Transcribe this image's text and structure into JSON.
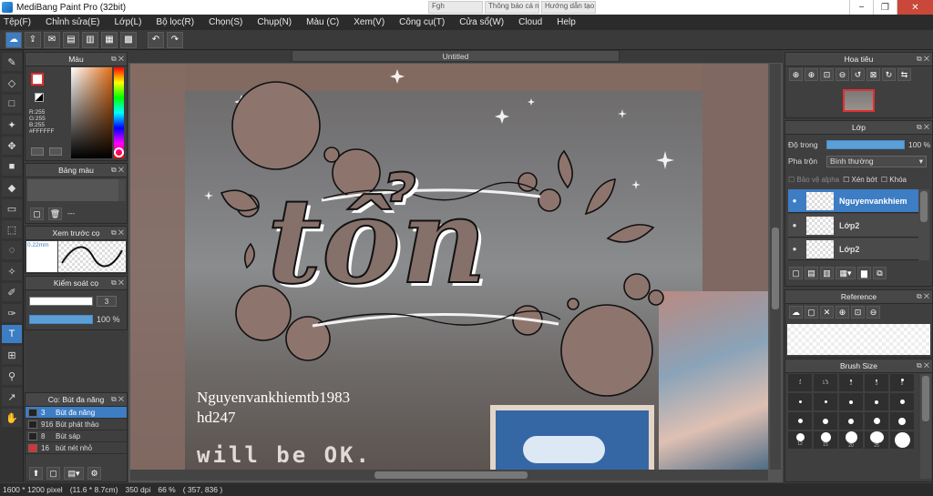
{
  "window": {
    "title": "MediBang Paint Pro (32bit)",
    "tabs": [
      "Fgh",
      "Thông báo cá nh",
      "Hướng dẫn tạo"
    ],
    "min": "−",
    "restore": "❐",
    "close": "✕"
  },
  "menu": [
    "Tệp(F)",
    "Chỉnh sửa(E)",
    "Lớp(L)",
    "Bộ lọc(R)",
    "Chọn(S)",
    "Chụp(N)",
    "Màu (C)",
    "Xem(V)",
    "Công cụ(T)",
    "Cửa sổ(W)",
    "Cloud",
    "Help"
  ],
  "canvas": {
    "tab_title": "Untitled",
    "watermark_line1": "Nguyenvankhiemtb1983",
    "watermark_line2": "hd247",
    "bottom_text": "will be OK.",
    "art_text": "tổn"
  },
  "color_panel": {
    "title": "Màu",
    "r": "R:255",
    "g": "G:255",
    "b": "B:255",
    "hex": "#FFFFFF",
    "primary": "#ffffff",
    "accent": "#e03030"
  },
  "palette_panel": {
    "title": "Bảng màu",
    "empty_text": "---"
  },
  "preview_panel": {
    "title": "Xem trước cọ",
    "size": "0.22mm"
  },
  "control_panel": {
    "title": "Kiểm soát cọ",
    "size_value": "3",
    "opacity_value": "100 %",
    "opacity_level": 1.0
  },
  "brush_panel": {
    "title": "Cọ: Bút đa năng",
    "items": [
      {
        "num": "3",
        "name": "Bút đa năng",
        "active": true
      },
      {
        "num": "916",
        "name": "Bút phát thảo",
        "active": false
      },
      {
        "num": "8",
        "name": "Bút sáp",
        "active": false
      },
      {
        "num": "16",
        "name": "bút nét nhỏ",
        "active": false
      }
    ]
  },
  "navigator": {
    "title": "Hoa tiêu"
  },
  "layer_panel": {
    "title": "Lớp",
    "opacity_label": "Độ trong",
    "opacity_value": "100 %",
    "opacity_level": 1.0,
    "blend_label": "Pha trộn",
    "blend_value": "Bình thường",
    "protect_alpha": "Bảo vệ alpha",
    "clipping": "Xén bớt",
    "lock": "Khóa",
    "layers": [
      {
        "name": "Nguyenvankhiem",
        "active": true
      },
      {
        "name": "Lớp2",
        "active": false
      },
      {
        "name": "Lớp2",
        "active": false
      }
    ]
  },
  "reference_panel": {
    "title": "Reference"
  },
  "brush_size_panel": {
    "title": "Brush Size",
    "sizes": [
      "1",
      "1.5",
      "2",
      "3",
      "5",
      "",
      "",
      "",
      "",
      "",
      "",
      "",
      "",
      "",
      "",
      "12",
      "15",
      "20",
      "25",
      ""
    ]
  },
  "status": {
    "pixels": "1600 * 1200 pixel",
    "cm": "(11.6 * 8.7cm)",
    "dpi": "350 dpi",
    "zoom": "66 %",
    "coords": "( 357, 836 )"
  }
}
